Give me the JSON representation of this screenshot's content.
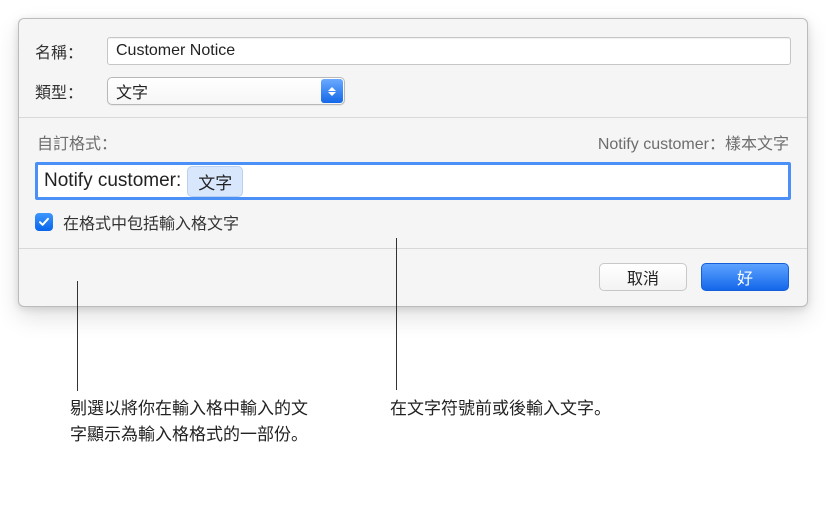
{
  "dialog": {
    "name_label": "名稱：",
    "name_value": "Customer Notice",
    "type_label": "類型：",
    "type_value": "文字",
    "custom_format_label": "自訂格式：",
    "preview": "Notify customer：樣本文字",
    "format_input_prefix": "Notify customer: ",
    "format_token": "文字",
    "checkbox_label": "在格式中包括輸入格文字",
    "cancel_label": "取消",
    "ok_label": "好"
  },
  "callouts": {
    "left": "剔選以將你在輸入格中輸入的文字顯示為輸入格格式的一部份。",
    "right": "在文字符號前或後輸入文字。"
  }
}
